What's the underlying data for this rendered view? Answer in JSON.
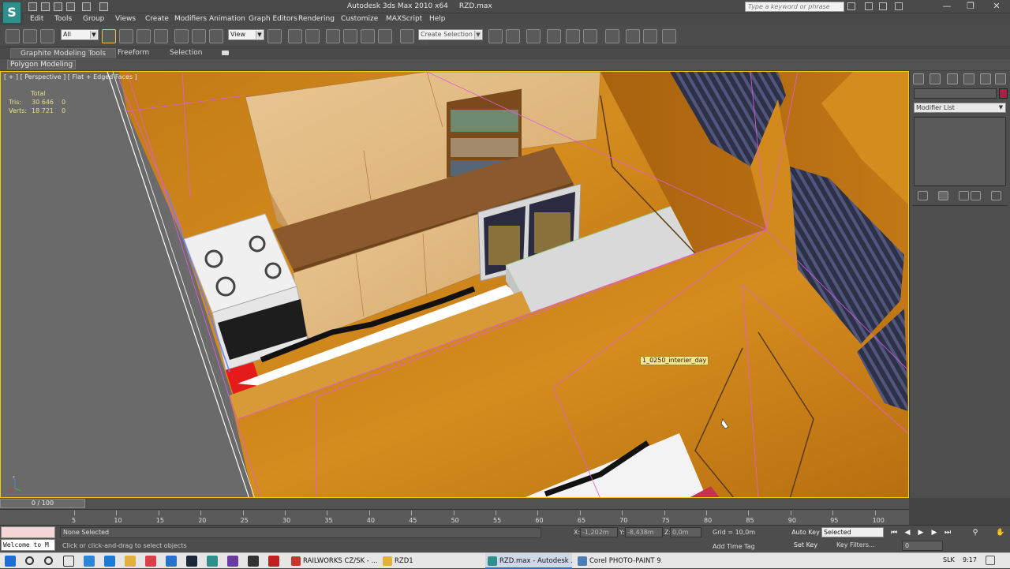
{
  "window": {
    "app_title": "Autodesk 3ds Max  2010 x64",
    "file_title": "RZD.max",
    "help_search_placeholder": "Type a keyword or phrase",
    "minimize": "—",
    "restore": "❐",
    "close": "✕",
    "logo": "S"
  },
  "menu": [
    "Edit",
    "Tools",
    "Group",
    "Views",
    "Create",
    "Modifiers",
    "Animation",
    "Graph Editors",
    "Rendering",
    "Customize",
    "MAXScript",
    "Help"
  ],
  "toolbar": {
    "selection_filter": "All",
    "ref_coord": "View",
    "named_selection": "Create Selection Se"
  },
  "ribbon": {
    "tabs": [
      "Graphite Modeling Tools",
      "Freeform",
      "Selection"
    ],
    "active_subtab": "Polygon Modeling"
  },
  "viewport": {
    "label": "[ + ] [ Perspective ] [ Flat + Edged Faces ]",
    "stats": {
      "header": "Total",
      "tris_label": "Tris:",
      "tris_total": "30 646",
      "tris_sel": "0",
      "verts_label": "Verts:",
      "verts_total": "18 721",
      "verts_sel": "0"
    },
    "object_tooltip": "1_0250_interier_day",
    "axis_labels": {
      "x": "x",
      "y": "y",
      "z": "z"
    }
  },
  "command_panel": {
    "modifier_list": "Modifier List",
    "object_color": "#a8204a"
  },
  "timeline": {
    "slider_label": "0 / 100",
    "ticks": [
      "5",
      "10",
      "15",
      "20",
      "25",
      "30",
      "35",
      "40",
      "45",
      "50",
      "55",
      "60",
      "65",
      "70",
      "75",
      "80",
      "85",
      "90",
      "95",
      "100"
    ]
  },
  "status": {
    "maxscript_text": "Welcome to M",
    "selection": "None Selected",
    "prompt": "Click or click-and-drag to select objects",
    "x_label": "X:",
    "x_value": "-1,202m",
    "y_label": "Y:",
    "y_value": "-8,438m",
    "z_label": "Z:",
    "z_value": "0,0m",
    "grid": "Grid = 10,0m",
    "add_time_tag": "Add Time Tag",
    "auto_key": "Auto Key",
    "set_key": "Set Key",
    "key_mode": "Selected",
    "key_filters": "Key Filters...",
    "frame": "0"
  },
  "taskbar": {
    "apps": [
      {
        "label": "RAILWORKS CZ/SK - ...",
        "color": "#c0392b"
      },
      {
        "label": "RZD1",
        "color": "#e2b13c"
      },
      {
        "label": "RZD.max - Autodesk ...",
        "color": "#2f8f8a"
      },
      {
        "label": "Corel PHOTO-PAINT 9...",
        "color": "#4a7fb5"
      }
    ],
    "language": "SLK",
    "time": "9:17"
  }
}
